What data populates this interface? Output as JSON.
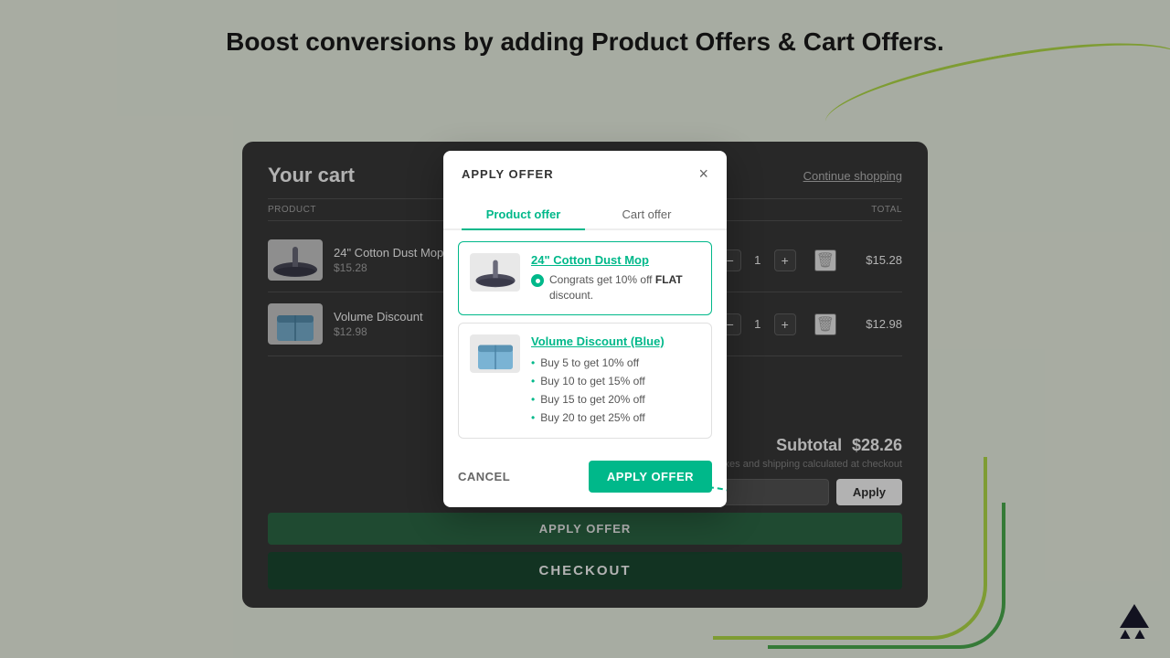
{
  "page": {
    "headline": "Boost conversions by adding Product Offers & Cart Offers.",
    "background_color": "#f0f7e8"
  },
  "cart": {
    "title": "Your cart",
    "continue_shopping": "Continue shopping",
    "columns": {
      "product": "PRODUCT",
      "total": "TOTAL"
    },
    "items": [
      {
        "id": "item-1",
        "name": "24\" Cotton Dust Mop",
        "price": "$15.28",
        "total": "$15.28",
        "qty": "1",
        "image_type": "dust-mop"
      },
      {
        "id": "item-2",
        "name": "Volume Discount",
        "price": "$12.98",
        "total": "$12.98",
        "qty": "1",
        "image_type": "blue-box"
      }
    ],
    "subtotal_label": "Subtotal",
    "subtotal_value": "$28.26",
    "taxes_note": "Taxes and shipping calculated at checkout",
    "coupon_placeholder": "",
    "apply_button_label": "Apply",
    "apply_offer_button_label": "APPLY OFFER",
    "checkout_button_label": "CHECKOUT"
  },
  "modal": {
    "title": "APPLY OFFER",
    "close_label": "×",
    "tabs": [
      {
        "id": "product-offer",
        "label": "Product offer",
        "active": true
      },
      {
        "id": "cart-offer",
        "label": "Cart offer",
        "active": false
      }
    ],
    "offers": [
      {
        "id": "offer-1",
        "name": "24\" Cotton Dust Mop",
        "description": "Congrats get 10% off FLAT discount.",
        "selected": true,
        "image_type": "dust-mop"
      },
      {
        "id": "offer-2",
        "name": "Volume Discount (Blue)",
        "selected": false,
        "image_type": "blue-box",
        "tiers": [
          "Buy 5 to get 10% off",
          "Buy 10 to get 15% off",
          "Buy 15 to get 20% off",
          "Buy 20 to get 25% off"
        ]
      }
    ],
    "cancel_label": "CANCEL",
    "apply_label": "APPLY OFFER"
  },
  "colors": {
    "teal": "#00b88a",
    "dark_green": "#1a4a32",
    "medium_green": "#2d6b47",
    "cart_bg": "#3a3a3a"
  }
}
